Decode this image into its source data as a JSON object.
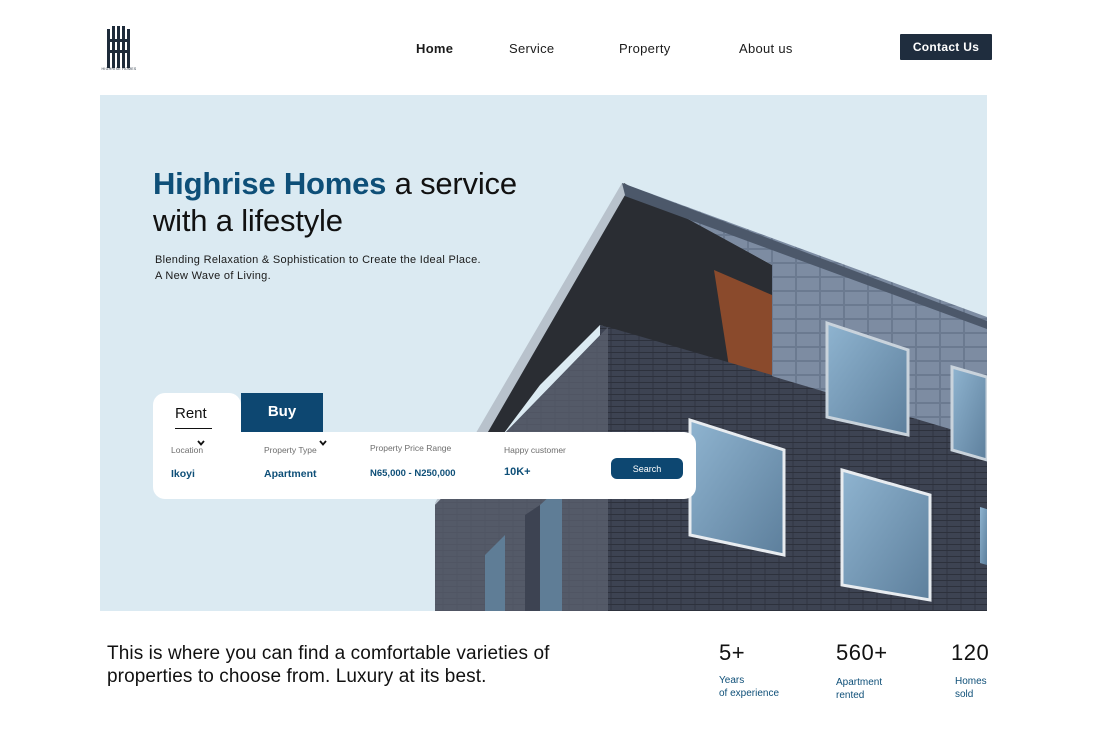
{
  "header": {
    "logo_text": "HIGHRISE HOMES",
    "nav": [
      {
        "label": "Home",
        "active": true
      },
      {
        "label": "Service",
        "active": false
      },
      {
        "label": "Property",
        "active": false
      },
      {
        "label": "About us",
        "active": false
      }
    ],
    "contact_label": "Contact Us"
  },
  "hero": {
    "title_brand": "Highrise Homes",
    "title_rest_1": " a service",
    "title_line_2": "with a lifestyle",
    "subtitle_line_1": "Blending Relaxation & Sophistication to Create the Ideal Place.",
    "subtitle_line_2": "A New Wave of Living."
  },
  "search": {
    "tabs": {
      "rent": "Rent",
      "buy": "Buy"
    },
    "fields": [
      {
        "label": "Location",
        "value": "Ikoyi"
      },
      {
        "label": "Property Type",
        "value": "Apartment"
      },
      {
        "label": "Property Price Range",
        "value": "N65,000 - N250,000"
      },
      {
        "label": "Happy customer",
        "value": "10K+"
      }
    ],
    "button_label": "Search"
  },
  "intro": {
    "line_1": "This is where you can find a comfortable varieties of",
    "line_2": "properties to choose from. Luxury at its best."
  },
  "stats": [
    {
      "value": "5+",
      "label_1": "Years",
      "label_2": "of experience"
    },
    {
      "value": "560+",
      "label_1": "Apartment",
      "label_2": "rented"
    },
    {
      "value": "120",
      "label_1": "Homes",
      "label_2": "sold"
    }
  ],
  "colors": {
    "brand": "#0e4f78",
    "button_dark": "#1f2d3e",
    "hero_bg": "#dbeaf2"
  }
}
